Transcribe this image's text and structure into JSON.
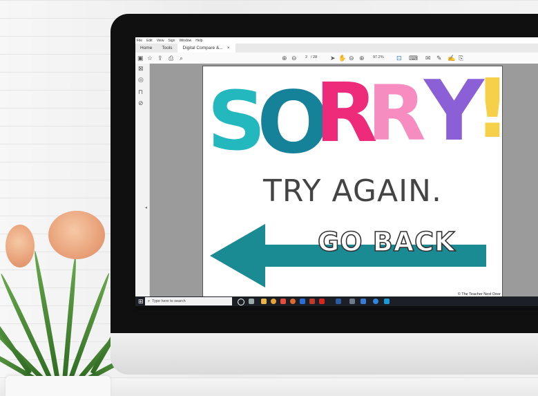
{
  "acrobat": {
    "menu": [
      "File",
      "Edit",
      "View",
      "Sign",
      "Window",
      "Help"
    ],
    "tabs": {
      "home": "Home",
      "tools": "Tools",
      "document": "Digital Compare &...",
      "close": "×"
    },
    "page_current": "2",
    "page_total": "/ 28",
    "zoom": "97.2%"
  },
  "slide": {
    "headline_letters": [
      {
        "char": "S",
        "color": "#22b8bd"
      },
      {
        "char": "O",
        "color": "#16829a"
      },
      {
        "char": "R",
        "color": "#ee2a7b"
      },
      {
        "char": "R",
        "color": "#f68cc0"
      },
      {
        "char": "Y",
        "color": "#8b5fd6"
      },
      {
        "char": "!",
        "color": "#f7d04a"
      }
    ],
    "subtitle": "TRY AGAIN.",
    "button_text": "GO BACK",
    "arrow_color": "#1a8a93",
    "copyright": "© The Teacher Next Door"
  },
  "taskbar": {
    "search_placeholder": "Type here to search"
  }
}
